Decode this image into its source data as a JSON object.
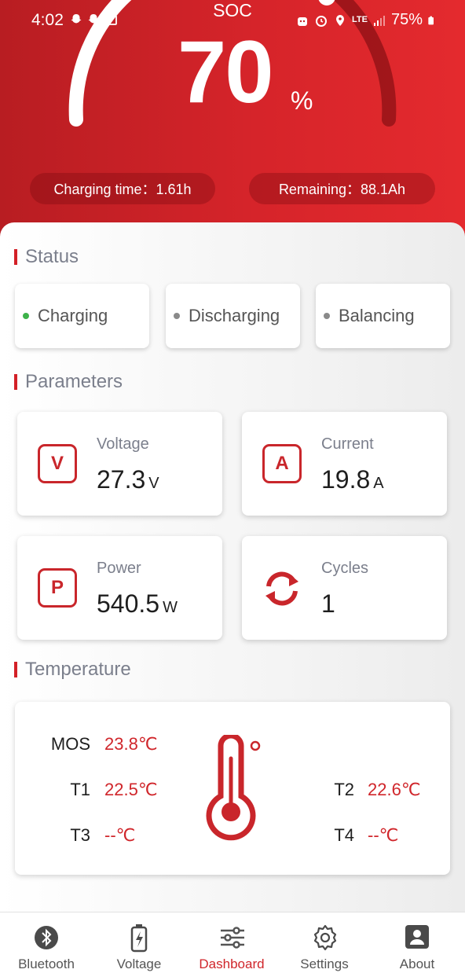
{
  "status_bar": {
    "time": "4:02",
    "network": "LTE",
    "battery": "75%"
  },
  "hero": {
    "soc_label": "SOC",
    "soc_value": "70",
    "soc_unit": "%",
    "soc_fraction": 0.7,
    "charging_time": "Charging time：1.61h",
    "remaining": "Remaining：88.1Ah"
  },
  "status": {
    "title": "Status",
    "items": [
      {
        "label": "Charging",
        "active": true
      },
      {
        "label": "Discharging",
        "active": false
      },
      {
        "label": "Balancing",
        "active": false
      }
    ]
  },
  "parameters": {
    "title": "Parameters",
    "voltage": {
      "icon": "V",
      "label": "Voltage",
      "value": "27.3",
      "unit": "V"
    },
    "current": {
      "icon": "A",
      "label": "Current",
      "value": "19.8",
      "unit": "A"
    },
    "power": {
      "icon": "P",
      "label": "Power",
      "value": "540.5",
      "unit": "W"
    },
    "cycles": {
      "icon": "refresh-icon",
      "label": "Cycles",
      "value": "1"
    }
  },
  "temperature": {
    "title": "Temperature",
    "mos": {
      "name": "MOS",
      "value": "23.8℃"
    },
    "t1": {
      "name": "T1",
      "value": "22.5℃"
    },
    "t2": {
      "name": "T2",
      "value": "22.6℃"
    },
    "t3": {
      "name": "T3",
      "value": "--℃"
    },
    "t4": {
      "name": "T4",
      "value": "--℃"
    }
  },
  "nav": {
    "items": [
      {
        "label": "Bluetooth",
        "icon": "bluetooth-icon"
      },
      {
        "label": "Voltage",
        "icon": "battery-icon"
      },
      {
        "label": "Dashboard",
        "icon": "sliders-icon",
        "active": true
      },
      {
        "label": "Settings",
        "icon": "gear-icon"
      },
      {
        "label": "About",
        "icon": "person-icon"
      }
    ]
  },
  "colors": {
    "accent": "#d0262b",
    "active_dot": "#3db24a",
    "inactive_dot": "#8a8a8a"
  }
}
